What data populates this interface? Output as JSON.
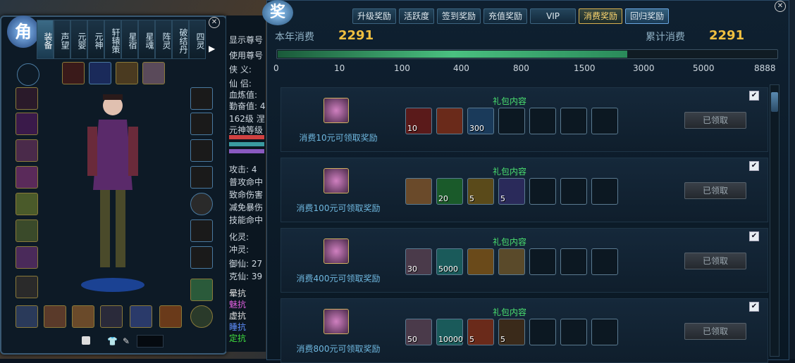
{
  "left_panel": {
    "emblem": "角",
    "tabs": [
      "装备",
      "声望",
      "元婴",
      "元神",
      "轩辕策",
      "星宿",
      "星魂",
      "阵灵",
      "破结丹",
      "四灵"
    ],
    "stats": [
      "显示尊号",
      "使用尊号",
      "侠 义:",
      "仙 侣:",
      "血炼值:",
      "勤奋值: 4",
      "162级 涅",
      "元神等级",
      "攻击: 4",
      "普攻命中",
      "致命伤害",
      "减免暴伤",
      "技能命中",
      "化灵:",
      "冲灵:",
      "御仙: 27",
      "克仙: 39",
      "晕抗",
      "魅抗",
      "虚抗",
      "睡抗",
      "定抗"
    ],
    "stat_colors": {
      "charm": "#e060e0",
      "sleep": "#6090ff",
      "fixed": "#40e040"
    }
  },
  "main": {
    "ornament": "奖",
    "tabs": [
      "升级奖励",
      "活跃度",
      "签到奖励",
      "充值奖励",
      "VIP",
      "消费奖励",
      "回归奖励"
    ],
    "active_tab": "消费奖励",
    "year_label": "本年消费",
    "year_value": "2291",
    "total_label": "累计消费",
    "total_value": "2291",
    "ticks": [
      "0",
      "10",
      "100",
      "400",
      "800",
      "1500",
      "3000",
      "5000",
      "8888"
    ],
    "progress_fraction": 0.7,
    "rows": [
      {
        "title": "礼包内容",
        "label": "消费10元可领取奖励",
        "claim": "已领取",
        "counts": [
          "10",
          "",
          "300",
          "",
          "",
          "",
          ""
        ]
      },
      {
        "title": "礼包内容",
        "label": "消费100元可领取奖励",
        "claim": "已领取",
        "counts": [
          "",
          "20",
          "5",
          "5",
          "",
          "",
          ""
        ]
      },
      {
        "title": "礼包内容",
        "label": "消费400元可领取奖励",
        "claim": "已领取",
        "counts": [
          "30",
          "5000",
          "",
          "",
          "",
          "",
          ""
        ]
      },
      {
        "title": "礼包内容",
        "label": "消费800元可领取奖励",
        "claim": "已领取",
        "counts": [
          "50",
          "10000",
          "5",
          "5",
          "",
          "",
          ""
        ]
      }
    ]
  }
}
